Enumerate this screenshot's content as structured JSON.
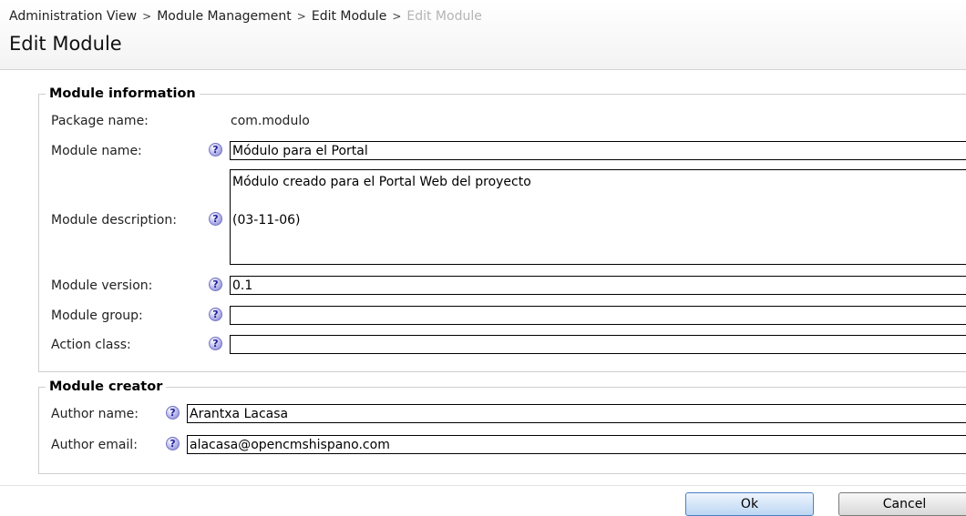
{
  "header": {
    "breadcrumb": [
      "Administration View",
      "Module Management",
      "Edit Module",
      "Edit Module"
    ],
    "separator": ">",
    "title": "Edit Module"
  },
  "module_information": {
    "legend": "Module information",
    "package_label": "Package name:",
    "package_value": "com.modulo",
    "name_label": "Module name:",
    "name_value": "Módulo para el Portal",
    "description_label": "Module description:",
    "description_value": "Módulo creado para el Portal Web del proyecto\n\n(03-11-06)",
    "version_label": "Module version:",
    "version_value": "0.1",
    "group_label": "Module group:",
    "group_value": "",
    "action_label": "Action class:",
    "action_value": ""
  },
  "module_creator": {
    "legend": "Module creator",
    "author_name_label": "Author name:",
    "author_name_value": "Arantxa Lacasa",
    "author_email_label": "Author email:",
    "author_email_value": "alacasa@opencmshispano.com"
  },
  "help_glyph": "?",
  "icons": {
    "help": "help-question-icon"
  },
  "buttons": {
    "ok": "Ok",
    "cancel": "Cancel"
  },
  "colors": {
    "ok_border": "#4a7fc0",
    "help_icon": "#7e7ed2",
    "breadcrumb_current": "#b4b4b4"
  }
}
